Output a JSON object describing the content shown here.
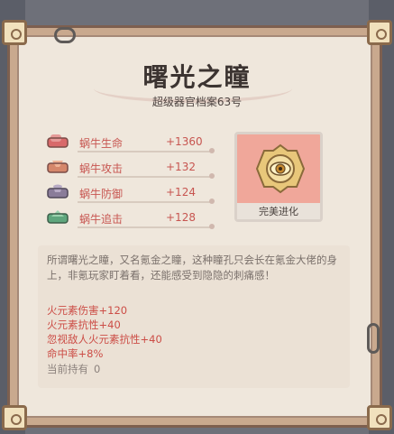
{
  "item": {
    "name": "曙光之瞳",
    "subtitle": "超级器官档案63号"
  },
  "stats": [
    {
      "label": "蜗牛生命",
      "value": "+1360",
      "icon": "heart-organ-icon",
      "color": "#d8696a"
    },
    {
      "label": "蜗牛攻击",
      "value": "+132",
      "icon": "sword-organ-icon",
      "color": "#d5876b"
    },
    {
      "label": "蜗牛防御",
      "value": "+124",
      "icon": "shield-organ-icon",
      "color": "#8a7c99"
    },
    {
      "label": "蜗牛追击",
      "value": "+128",
      "icon": "chase-organ-icon",
      "color": "#5fa67d"
    }
  ],
  "card": {
    "label": "完美进化",
    "icon": "golden-eye-badge-icon"
  },
  "description": "所谓曙光之瞳，又名氪金之瞳，这种瞳孔只会长在氪金大佬的身上，非氪玩家盯着看，还能感受到隐隐的刺痛感！",
  "effects": [
    "火元素伤害+120",
    "火元素抗性+40",
    "忽视敌人火元素抗性+40",
    "命中率+8%"
  ],
  "holding": {
    "label": "当前持有",
    "count": "0"
  }
}
